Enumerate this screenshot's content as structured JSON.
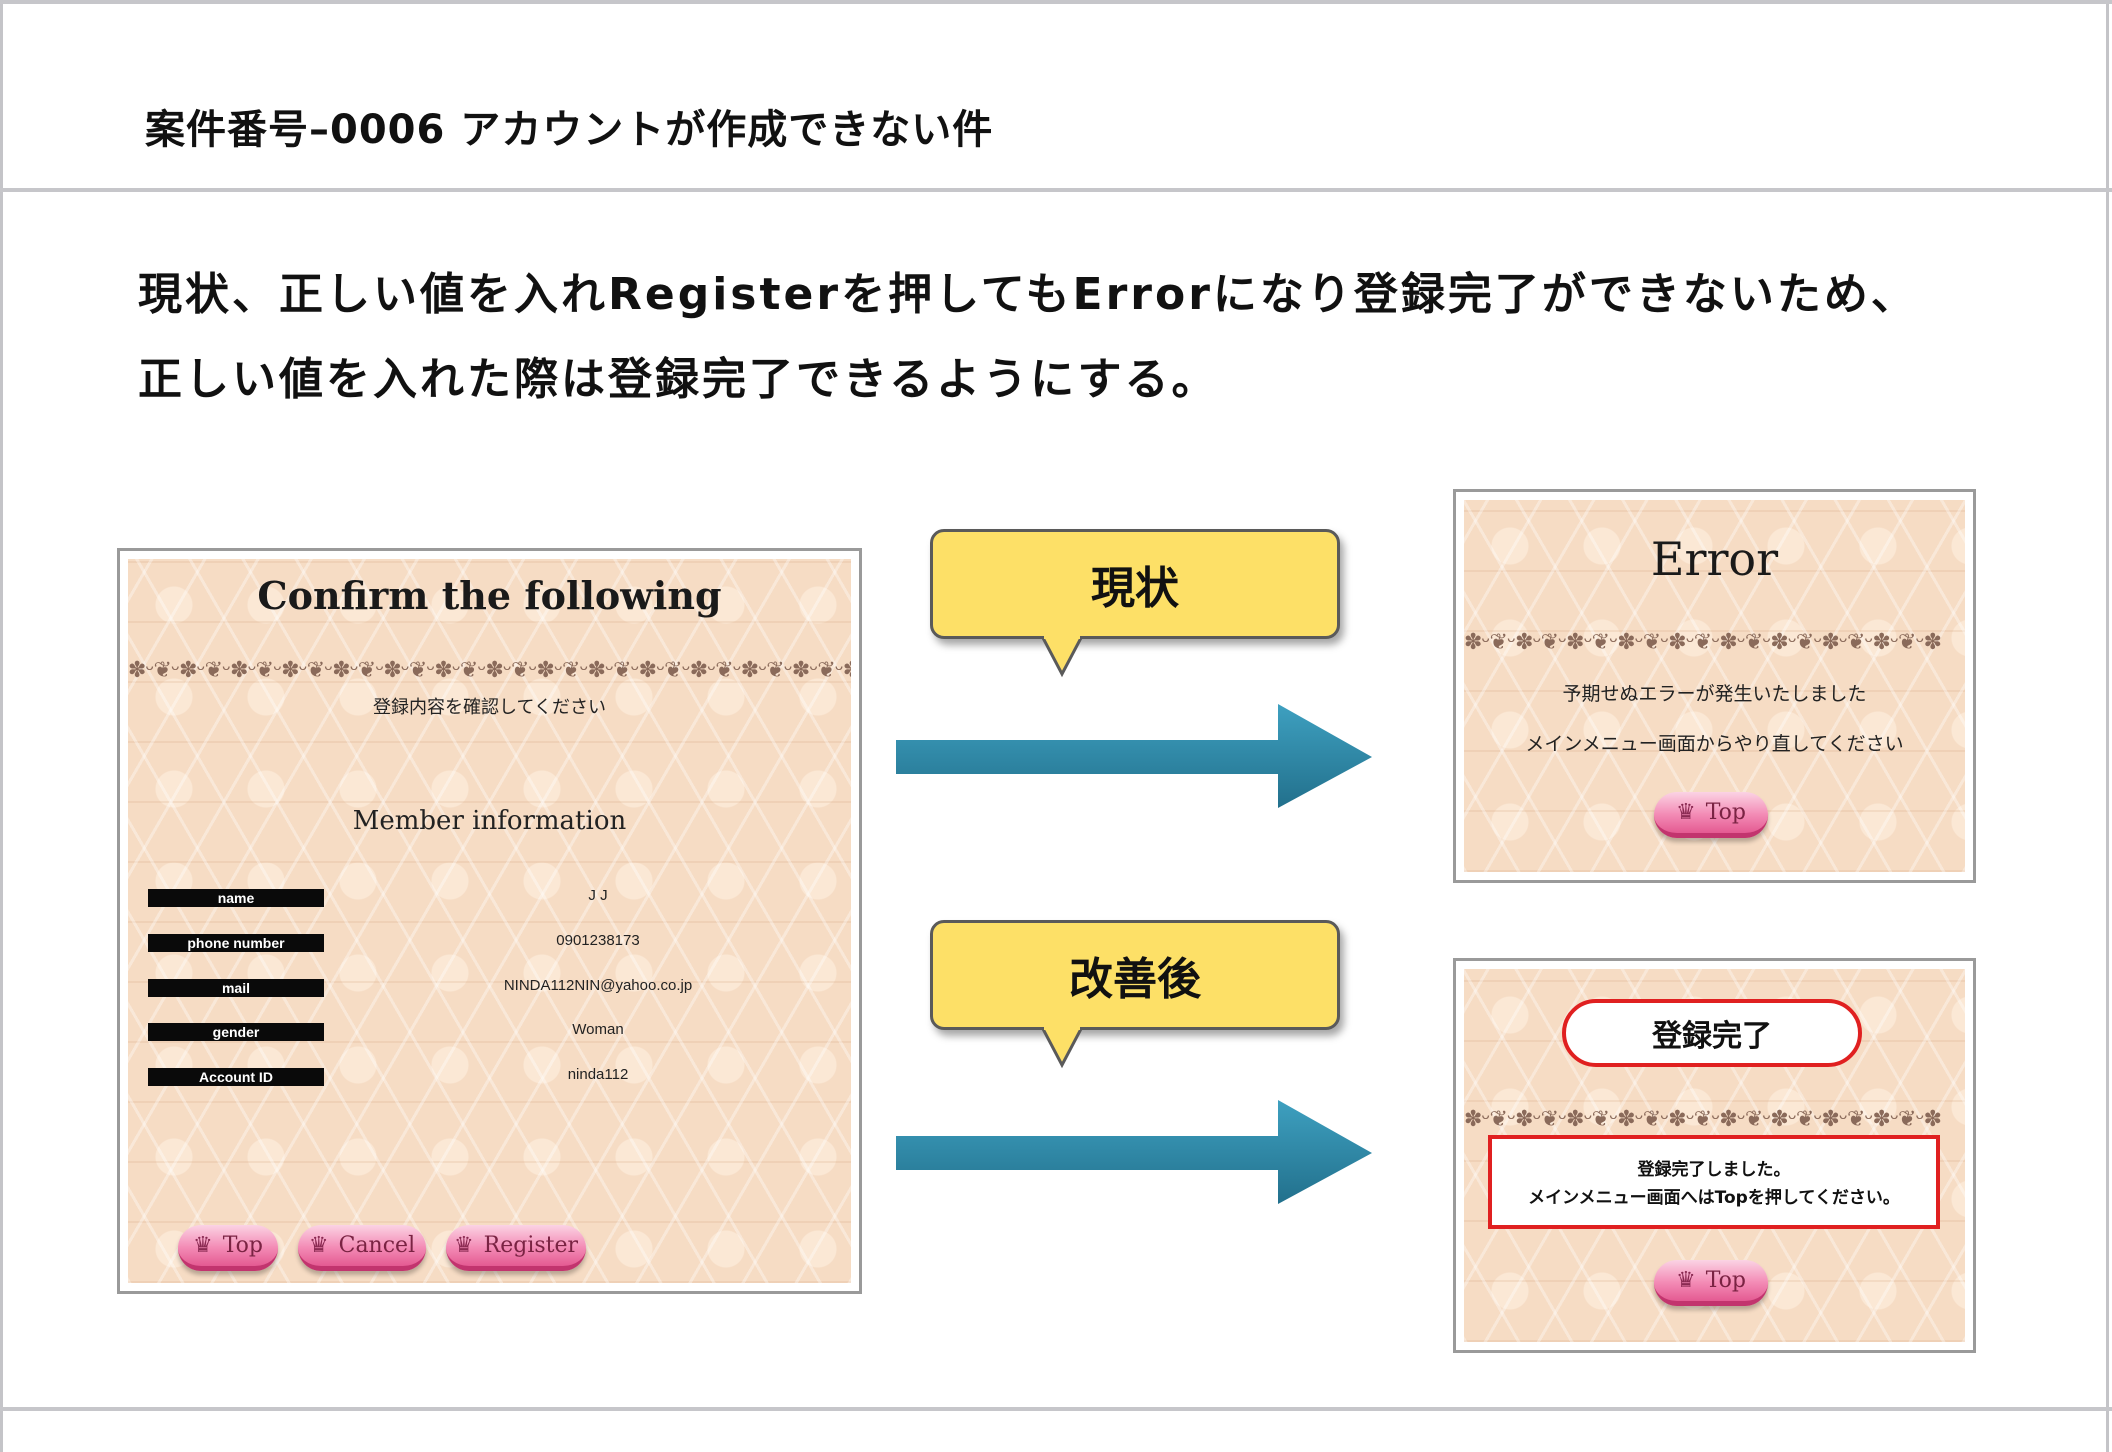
{
  "title": "案件番号–0006 アカウントが作成できない件",
  "description": {
    "line1": "現状、正しい値を入れRegisterを押してもErrorになり登録完了ができないため、",
    "line2": "正しい値を入れた際は登録完了できるようにする。"
  },
  "confirm_screen": {
    "heading": "Confirm the following",
    "subtitle": "登録内容を確認してください",
    "section": "Member information",
    "fields": [
      {
        "label": "name",
        "value": "J J"
      },
      {
        "label": "phone number",
        "value": "0901238173"
      },
      {
        "label": "mail",
        "value": "NINDA112NIN@yahoo.co.jp"
      },
      {
        "label": "gender",
        "value": "Woman"
      },
      {
        "label": "Account ID",
        "value": "ninda112"
      }
    ],
    "buttons": {
      "top": "Top",
      "cancel": "Cancel",
      "register": "Register"
    }
  },
  "callouts": {
    "current": "現状",
    "improved": "改善後"
  },
  "error_screen": {
    "heading": "Error",
    "line1": "予期せぬエラーが発生いたしました",
    "line2": "メインメニュー画面からやり直してください",
    "top_button": "Top"
  },
  "success_screen": {
    "heading": "登録完了",
    "line1": "登録完了しました。",
    "line2": "メインメニュー画面へはTopを押してください。",
    "top_button": "Top"
  },
  "colors": {
    "callout": "#fde067",
    "arrow": "#2e88a6",
    "highlight": "#e02020",
    "button": "#f38bb5"
  },
  "icons": {
    "button_icon": "crown-icon",
    "flow": "right-arrow-icon"
  }
}
